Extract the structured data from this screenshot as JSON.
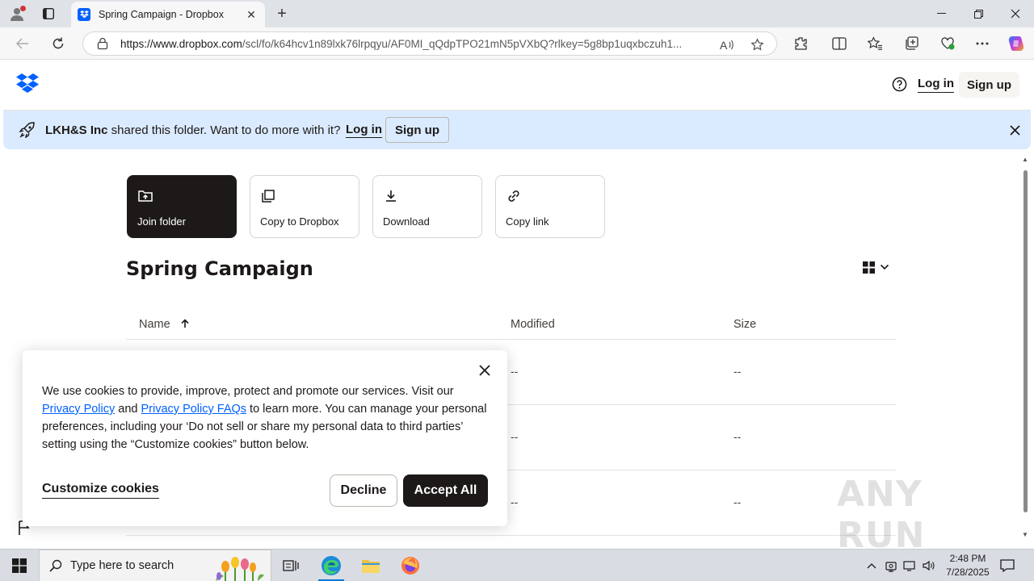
{
  "browser": {
    "tab_title": "Spring Campaign - Dropbox",
    "url_host": "https://www.dropbox.com",
    "url_path": "/scl/fo/k64hcv1n89lxk76lrpqyu/AF0MI_qQdpTPO21mN5pVXbQ?rlkey=5g8bp1uqxbczuh1...",
    "accent": "#0061fe"
  },
  "header": {
    "login_label": "Log in",
    "signup_label": "Sign up"
  },
  "banner": {
    "company": "LKH&S Inc",
    "message": " shared this folder. Want to do more with it?",
    "login_label": "Log in",
    "signup_label": "Sign up"
  },
  "actions": [
    {
      "label": "Join folder",
      "icon": "join-folder-icon"
    },
    {
      "label": "Copy to Dropbox",
      "icon": "copy-icon"
    },
    {
      "label": "Download",
      "icon": "download-icon"
    },
    {
      "label": "Copy link",
      "icon": "link-icon"
    }
  ],
  "folder": {
    "title": "Spring Campaign"
  },
  "table": {
    "columns": {
      "name": "Name",
      "modified": "Modified",
      "size": "Size"
    },
    "rows": [
      {
        "modified": "--",
        "size": "--"
      },
      {
        "modified": "--",
        "size": "--"
      },
      {
        "modified": "--",
        "size": "--"
      }
    ]
  },
  "cookie": {
    "text_1": "We use cookies to provide, improve, protect and promote our services. Visit our ",
    "link_privacy": "Privacy Policy",
    "text_2": " and ",
    "link_faqs": "Privacy Policy FAQs",
    "text_3": " to learn more. You can manage your personal preferences, including your ‘Do not sell or share my personal data to third parties’ setting using the “Customize cookies” button below.",
    "customize_label": "Customize cookies",
    "decline_label": "Decline",
    "accept_label": "Accept All"
  },
  "watermark": "ANY RUN",
  "taskbar": {
    "search_placeholder": "Type here to search",
    "time": "2:48 PM",
    "date": "7/28/2025"
  }
}
